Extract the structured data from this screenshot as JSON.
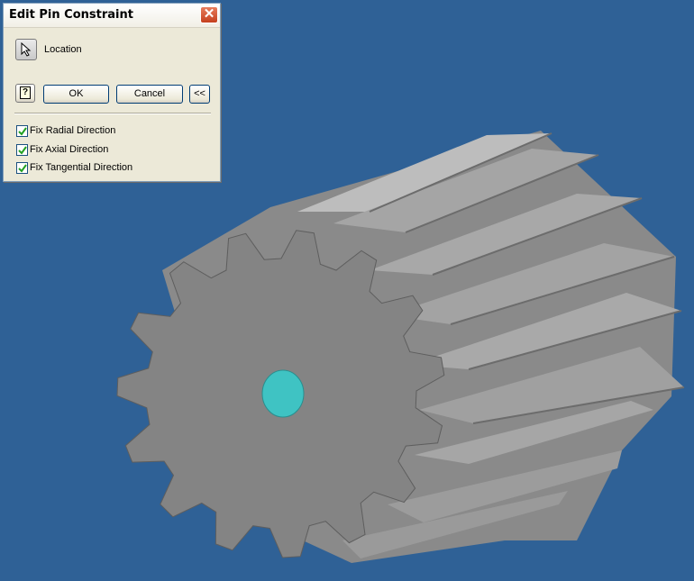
{
  "dialog": {
    "title": "Edit Pin Constraint",
    "close_glyph": "✕",
    "location_label": "Location",
    "help_glyph": "?",
    "ok_label": "OK",
    "cancel_label": "Cancel",
    "more_label": "<<",
    "options": [
      {
        "label": "Fix Radial Direction",
        "checked": true
      },
      {
        "label": "Fix Axial Direction",
        "checked": true
      },
      {
        "label": "Fix Tangential Direction",
        "checked": true
      }
    ]
  },
  "viewport": {
    "background_color": "#2f6196",
    "gear_face_color": "#848484",
    "gear_side_color": "#9a9a9a",
    "pin_color": "#3fc3c3",
    "gear_teeth": 15
  }
}
